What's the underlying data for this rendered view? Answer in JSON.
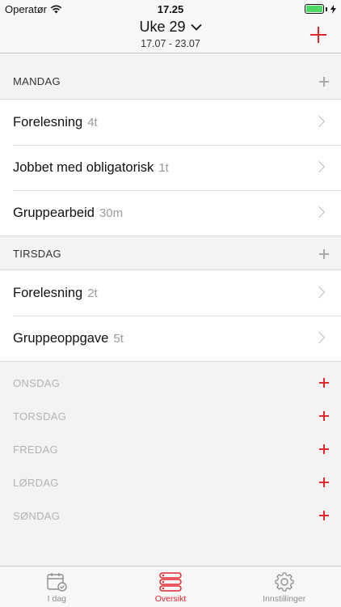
{
  "status": {
    "carrier": "Operatør",
    "time": "17.25"
  },
  "nav": {
    "title": "Uke 29",
    "subtitle": "17.07 - 23.07"
  },
  "days": [
    {
      "name": "MANDAG",
      "items": [
        {
          "title": "Forelesning",
          "duration": "4t"
        },
        {
          "title": "Jobbet med obligatorisk",
          "duration": "1t"
        },
        {
          "title": "Gruppearbeid",
          "duration": "30m"
        }
      ]
    },
    {
      "name": "TIRSDAG",
      "items": [
        {
          "title": "Forelesning",
          "duration": "2t"
        },
        {
          "title": "Gruppeoppgave",
          "duration": "5t"
        }
      ]
    },
    {
      "name": "ONSDAG",
      "items": []
    },
    {
      "name": "TORSDAG",
      "items": []
    },
    {
      "name": "FREDAG",
      "items": []
    },
    {
      "name": "LØRDAG",
      "items": []
    },
    {
      "name": "SØNDAG",
      "items": []
    }
  ],
  "tabs": [
    {
      "label": "I dag",
      "icon": "calendar-check-icon"
    },
    {
      "label": "Oversikt",
      "icon": "list-icon",
      "active": true
    },
    {
      "label": "Innstillinger",
      "icon": "gear-icon"
    }
  ],
  "colors": {
    "accent": "#e4262d",
    "battery": "#4cd964"
  }
}
